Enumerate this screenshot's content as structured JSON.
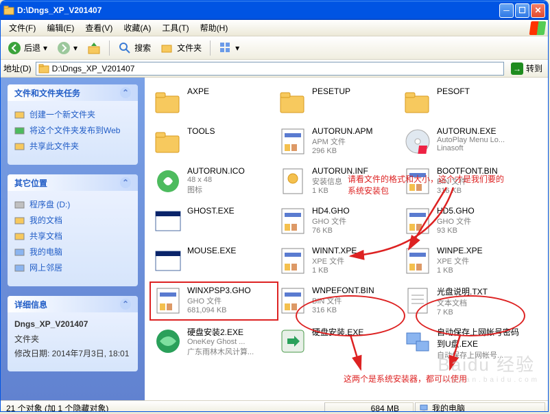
{
  "window": {
    "title": "D:\\Dngs_XP_V201407"
  },
  "menubar": [
    "文件(F)",
    "编辑(E)",
    "查看(V)",
    "收藏(A)",
    "工具(T)",
    "帮助(H)"
  ],
  "toolbar": {
    "back": "后退",
    "search": "搜索",
    "folders": "文件夹"
  },
  "addressbar": {
    "label": "地址(D)",
    "path": "D:\\Dngs_XP_V201407",
    "go": "转到"
  },
  "side": {
    "tasks_hdr": "文件和文件夹任务",
    "tasks": [
      {
        "label": "创建一个新文件夹",
        "icon": "new-folder-icon"
      },
      {
        "label": "将这个文件夹发布到Web",
        "icon": "publish-icon"
      },
      {
        "label": "共享此文件夹",
        "icon": "share-icon"
      }
    ],
    "other_hdr": "其它位置",
    "other": [
      {
        "label": "程序盘 (D:)",
        "icon": "drive-icon"
      },
      {
        "label": "我的文档",
        "icon": "docs-icon"
      },
      {
        "label": "共享文档",
        "icon": "shared-docs-icon"
      },
      {
        "label": "我的电脑",
        "icon": "computer-icon"
      },
      {
        "label": "网上邻居",
        "icon": "network-icon"
      }
    ],
    "detail_hdr": "详细信息",
    "detail": {
      "name": "Dngs_XP_V201407",
      "type": "文件夹",
      "mod": "修改日期: 2014年7月3日, 18:01"
    }
  },
  "files": [
    {
      "name": "AXPE",
      "meta1": "",
      "meta2": "",
      "icon": "folder"
    },
    {
      "name": "PESETUP",
      "meta1": "",
      "meta2": "",
      "icon": "folder"
    },
    {
      "name": "PESOFT",
      "meta1": "",
      "meta2": "",
      "icon": "folder"
    },
    {
      "name": "TOOLS",
      "meta1": "",
      "meta2": "",
      "icon": "folder"
    },
    {
      "name": "AUTORUN.APM",
      "meta1": "APM 文件",
      "meta2": "296 KB",
      "icon": "bin"
    },
    {
      "name": "AUTORUN.EXE",
      "meta1": "AutoPlay Menu Lo...",
      "meta2": "Linasoft",
      "icon": "disc"
    },
    {
      "name": "AUTORUN.ICO",
      "meta1": "48 x 48",
      "meta2": "图标",
      "icon": "ico"
    },
    {
      "name": "AUTORUN.INF",
      "meta1": "安装信息",
      "meta2": "1 KB",
      "icon": "inf"
    },
    {
      "name": "BOOTFONT.BIN",
      "meta1": "BIN 文件",
      "meta2": "316 KB",
      "icon": "bin"
    },
    {
      "name": "GHOST.EXE",
      "meta1": "",
      "meta2": "",
      "icon": "exe"
    },
    {
      "name": "HD4.GHO",
      "meta1": "GHO 文件",
      "meta2": "76 KB",
      "icon": "bin"
    },
    {
      "name": "HD5.GHO",
      "meta1": "GHO 文件",
      "meta2": "93 KB",
      "icon": "bin"
    },
    {
      "name": "MOUSE.EXE",
      "meta1": "",
      "meta2": "",
      "icon": "exe"
    },
    {
      "name": "WINNT.XPE",
      "meta1": "XPE 文件",
      "meta2": "1 KB",
      "icon": "bin"
    },
    {
      "name": "WINPE.XPE",
      "meta1": "XPE 文件",
      "meta2": "1 KB",
      "icon": "bin"
    },
    {
      "name": "WINXPSP3.GHO",
      "meta1": "GHO 文件",
      "meta2": "681,094 KB",
      "icon": "bin",
      "sel": true
    },
    {
      "name": "WNPEFONT.BIN",
      "meta1": "BIN 文件",
      "meta2": "316 KB",
      "icon": "bin"
    },
    {
      "name": "光盘说明.TXT",
      "meta1": "文本文档",
      "meta2": "7 KB",
      "icon": "txt"
    },
    {
      "name": "硬盘安装2.EXE",
      "meta1": "OneKey Ghost ...",
      "meta2": "广东雨林木风计算...",
      "icon": "green"
    },
    {
      "name": "硬盘安装.EXE",
      "meta1": "",
      "meta2": "",
      "icon": "green2"
    },
    {
      "name": "自动保存上网帐号密码到U盘.EXE",
      "meta1": "自动保存上网帐号...",
      "meta2": "",
      "icon": "net"
    }
  ],
  "annotations": {
    "text1a": "请看文件的格式和大小，这个才是我们要的",
    "text1b": "系统安装包",
    "text2": "这两个是系统安装器，都可以使用"
  },
  "status": {
    "left": "21 个对象 (加 1 个隐藏对象)",
    "size": "684 MB",
    "loc": "我的电脑"
  },
  "watermark": {
    "big": "Baidu 经验",
    "small": "jingyan.baidu.com"
  }
}
